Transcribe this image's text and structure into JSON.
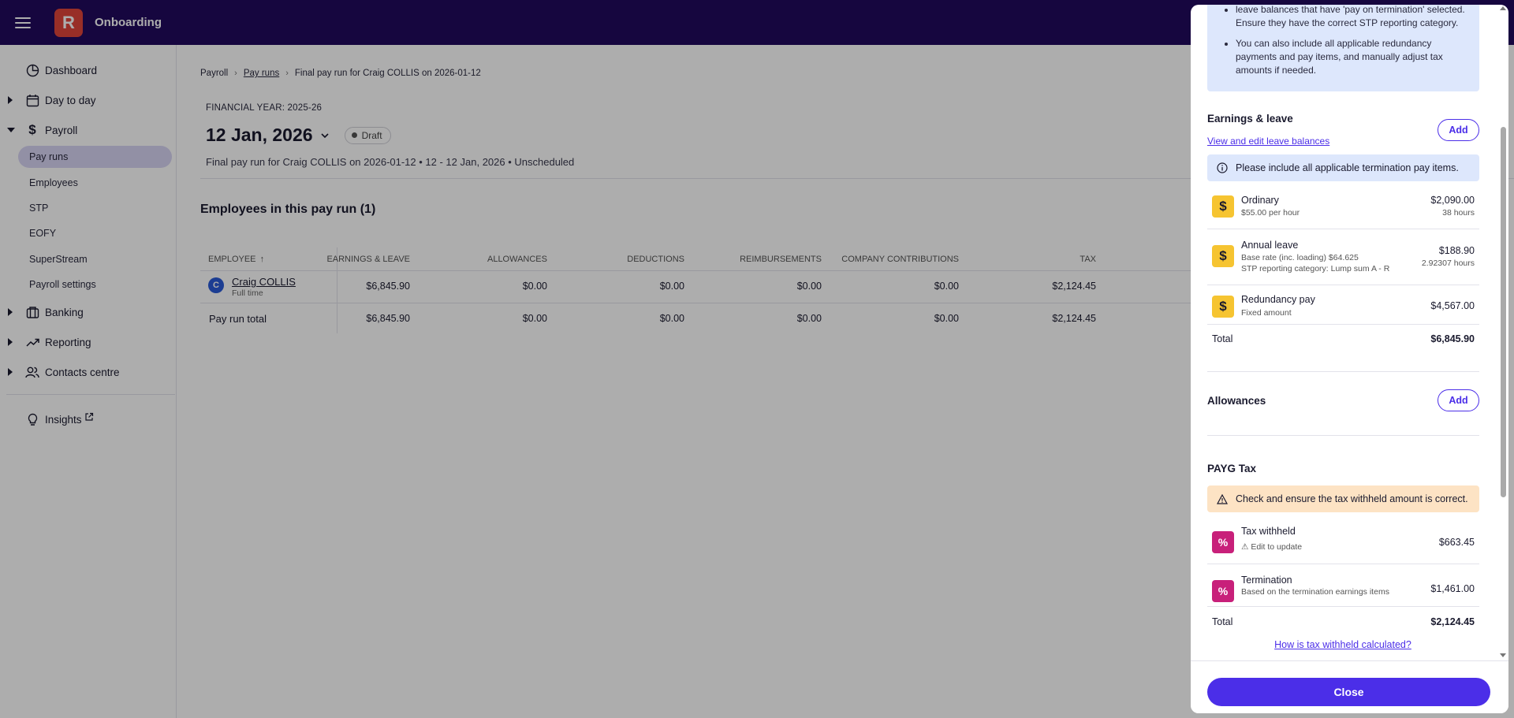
{
  "app": {
    "title": "Onboarding",
    "logo_letter": "R"
  },
  "sidebar": {
    "dashboard": "Dashboard",
    "day_to_day": "Day to day",
    "payroll": "Payroll",
    "payroll_items": [
      "Pay runs",
      "Employees",
      "STP",
      "EOFY",
      "SuperStream",
      "Payroll settings"
    ],
    "banking": "Banking",
    "reporting": "Reporting",
    "contacts": "Contacts centre",
    "insights": "Insights"
  },
  "breadcrumb": {
    "root": "Payroll",
    "pay_runs": "Pay runs",
    "current": "Final pay run for Craig COLLIS on 2026-01-12"
  },
  "pay_run": {
    "financial_year": "FINANCIAL YEAR: 2025-26",
    "date": "12 Jan, 2026",
    "status": "Draft",
    "subtitle": "Final pay run for Craig COLLIS on 2026-01-12 • 12 - 12 Jan, 2026 • Unscheduled",
    "section_title": "Employees in this pay run (1)"
  },
  "table": {
    "headers": [
      "EMPLOYEE",
      "EARNINGS & LEAVE",
      "ALLOWANCES",
      "DEDUCTIONS",
      "REIMBURSEMENTS",
      "COMPANY CONTRIBUTIONS",
      "TAX"
    ],
    "employee": {
      "initial": "C",
      "name": "Craig COLLIS",
      "type": "Full time",
      "values": [
        "$6,845.90",
        "$0.00",
        "$0.00",
        "$0.00",
        "$0.00",
        "$2,124.45"
      ]
    },
    "total": {
      "label": "Pay run total",
      "values": [
        "$6,845.90",
        "$0.00",
        "$0.00",
        "$0.00",
        "$0.00",
        "$2,124.45"
      ]
    }
  },
  "drawer": {
    "info_bullets": [
      "leave balances that have 'pay on termination' selected. Ensure they have the correct STP reporting category.",
      "You can also include all applicable redundancy payments and pay items, and manually adjust tax amounts if needed."
    ],
    "earnings": {
      "title": "Earnings & leave",
      "add_label": "Add",
      "link": "View and edit leave balances",
      "alert": "Please include all applicable termination pay items.",
      "items": [
        {
          "name": "Ordinary",
          "desc": "$55.00 per hour",
          "amount": "$2,090.00",
          "sub": "38 hours"
        },
        {
          "name": "Annual leave",
          "desc": "Base rate (inc. loading) $64.625",
          "desc2": "STP reporting category: Lump sum A - R",
          "amount": "$188.90",
          "sub": "2.92307 hours"
        },
        {
          "name": "Redundancy pay",
          "desc": "Fixed amount",
          "amount": "$4,567.00"
        }
      ],
      "total_label": "Total",
      "total_value": "$6,845.90"
    },
    "allowances": {
      "title": "Allowances",
      "add_label": "Add"
    },
    "tax": {
      "title": "PAYG Tax",
      "alert": "Check and ensure the tax withheld amount is correct.",
      "items": [
        {
          "name": "Tax withheld",
          "desc": "⚠ Edit to update",
          "amount": "$663.45"
        },
        {
          "name": "Termination",
          "desc": "Based on the termination earnings items",
          "amount": "$1,461.00"
        }
      ],
      "total_label": "Total",
      "total_value": "$2,124.45",
      "link": "How is tax withheld calculated?"
    },
    "close_label": "Close"
  },
  "colors": {
    "topbar": "#21095e",
    "accent": "#4b2ee8",
    "logo": "#e0443a",
    "money_icon": "#f6c431",
    "tax_icon": "#c8207a"
  }
}
